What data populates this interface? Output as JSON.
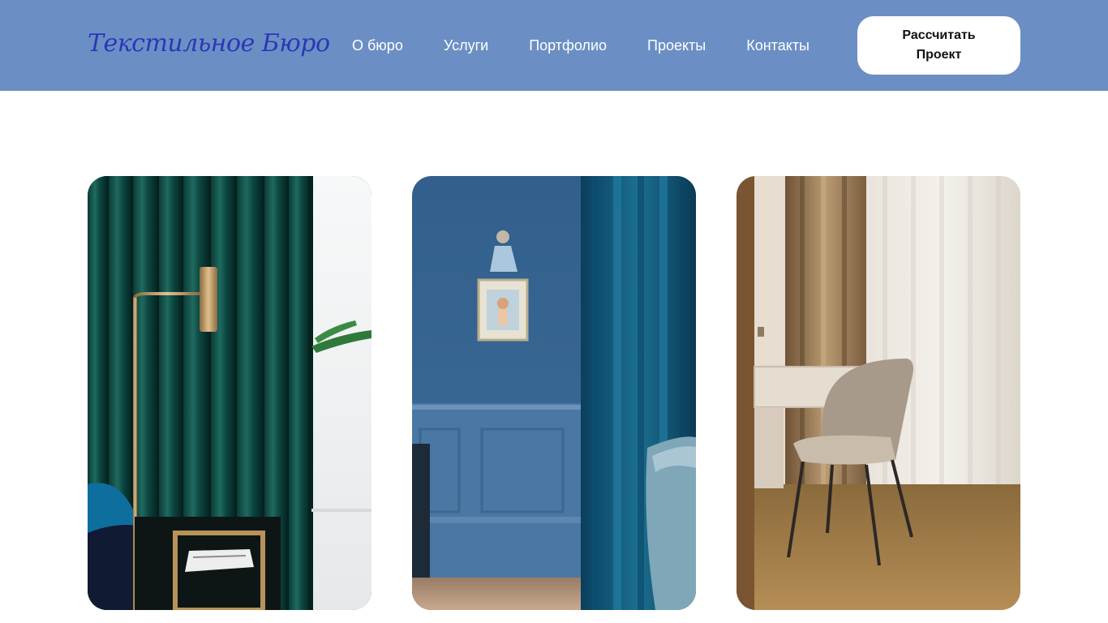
{
  "header": {
    "logo": "Текстильное Бюро",
    "background_color": "#6b8fc4",
    "logo_color": "#2b37b8"
  },
  "nav": {
    "items": [
      {
        "label": "О бюро"
      },
      {
        "label": "Услуги"
      },
      {
        "label": "Портфолио"
      },
      {
        "label": "Проекты"
      },
      {
        "label": "Контакты"
      }
    ]
  },
  "cta": {
    "label": "Рассчитать Проект"
  },
  "gallery": {
    "images": [
      {
        "subject": "dark green velvet curtain with brass floor lamp"
      },
      {
        "subject": "blue wall with blue velvet curtain, framed picture and wall sconce"
      },
      {
        "subject": "beige curtains with sheer tulle, desk and chair on herringbone parquet"
      }
    ]
  }
}
